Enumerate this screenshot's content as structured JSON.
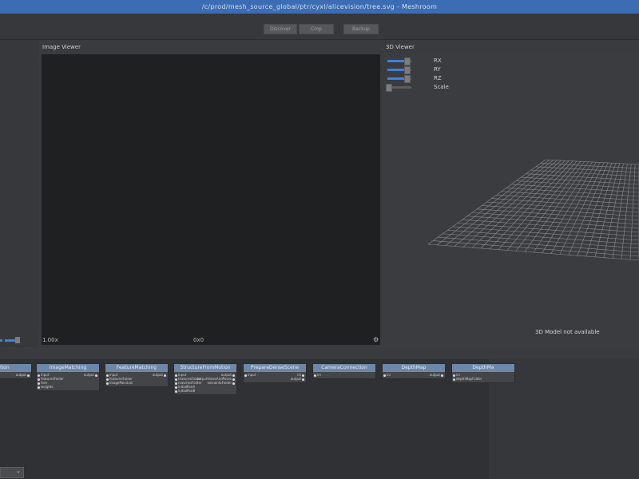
{
  "window": {
    "title": "/c/prod/mesh_source_global/ptr/cyxl/alicevision/tree.svg - Meshroom"
  },
  "toolbar": {
    "buttons": [
      "Discover",
      "Cmp",
      "Backup"
    ]
  },
  "image_viewer": {
    "title": "Image Viewer",
    "zoom": "1.00x",
    "resolution": "0x0"
  },
  "viewer_3d": {
    "title": "3D Viewer",
    "sliders": [
      {
        "label": "RX",
        "value": 0.8
      },
      {
        "label": "RY",
        "value": 0.8
      },
      {
        "label": "RZ",
        "value": 0.8
      },
      {
        "label": "Scale",
        "value": 0.0
      }
    ],
    "status": "3D Model not available"
  },
  "graph": {
    "nodes": [
      {
        "name": "traction",
        "inputs": [],
        "outputs": [
          "output"
        ]
      },
      {
        "name": "ImageMatching",
        "inputs": [
          "input",
          "featuresFolder",
          "tree",
          "weights"
        ],
        "outputs": [
          "output"
        ]
      },
      {
        "name": "FeatureMatching",
        "inputs": [
          "input",
          "featuresFolder",
          "imagePairsList"
        ],
        "outputs": [
          "output"
        ]
      },
      {
        "name": "StructureFromMotion",
        "inputs": [
          "input",
          "featuresFolder",
          "matchesFolder",
          "initialPairA",
          "initialPairB"
        ],
        "outputs": [
          "output",
          "outputViewsAndPoses",
          "extraInfoFolder"
        ]
      },
      {
        "name": "PrepareDenseScene",
        "inputs": [
          "input"
        ],
        "outputs": [
          "ini",
          "output"
        ]
      },
      {
        "name": "CameraConnection",
        "inputs": [
          "ini"
        ],
        "outputs": []
      },
      {
        "name": "DepthMap",
        "inputs": [
          "ini"
        ],
        "outputs": [
          "output"
        ]
      },
      {
        "name": "DepthMa",
        "inputs": [
          "ini",
          "depthMapFolder"
        ],
        "outputs": []
      }
    ]
  }
}
